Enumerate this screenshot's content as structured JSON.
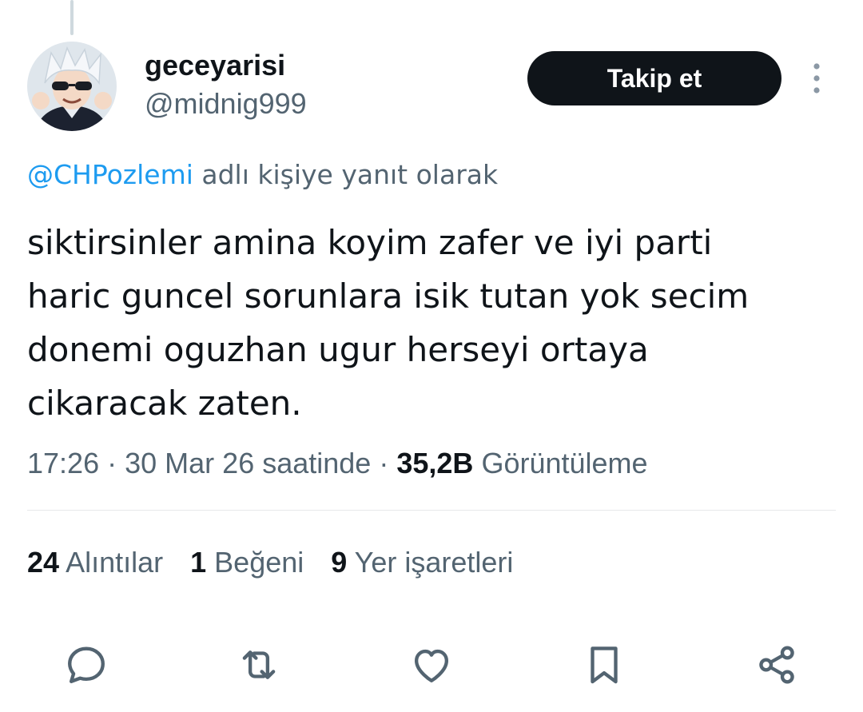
{
  "author": {
    "display_name": "geceyarisi",
    "handle": "@midnig999"
  },
  "follow_button_label": "Takip et",
  "reply_context": {
    "mention": "@CHPozlemi",
    "suffix": "adlı kişiye yanıt olarak"
  },
  "tweet": {
    "lines": [
      "siktirsinler amina koyim zafer ve iyi parti",
      "haric guncel sorunlara isik tutan yok secim",
      "donemi oguzhan ugur herseyi ortaya",
      "cikaracak zaten."
    ]
  },
  "meta": {
    "time": "17:26",
    "separator": "·",
    "date": "30 Mar 26 saatinde",
    "views_count": "35,2B",
    "views_label": "Görüntüleme"
  },
  "stats": {
    "quotes_count": "24",
    "quotes_label": "Alıntılar",
    "likes_count": "1",
    "likes_label": "Beğeni",
    "bookmarks_count": "9",
    "bookmarks_label": "Yer işaretleri"
  },
  "actions": [
    "reply-icon",
    "retweet-icon",
    "like-icon",
    "bookmark-icon",
    "share-icon"
  ],
  "colors": {
    "text": "#0f1419",
    "secondary": "#536471",
    "link": "#1d9bf0",
    "button_bg": "#0f1419",
    "divider": "#e7e9ea"
  }
}
